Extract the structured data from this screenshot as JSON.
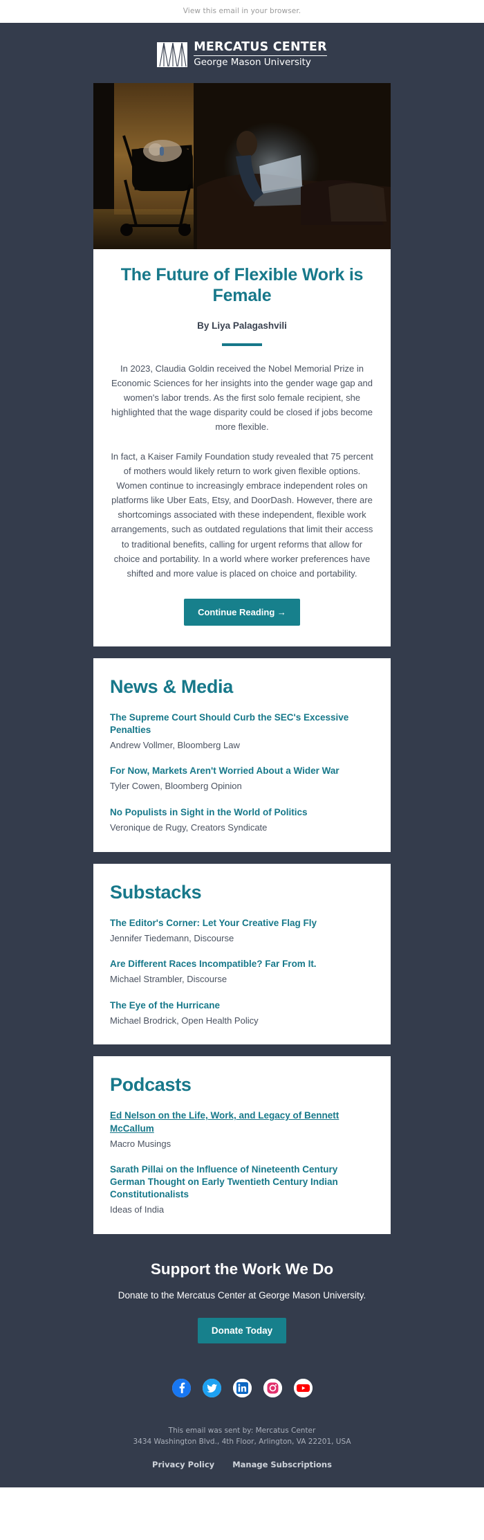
{
  "preheader": {
    "text": "View this email in your browser."
  },
  "brand": {
    "name_top": "MERCATUS CENTER",
    "name_bottom": "George Mason University",
    "logo_icon": "mercatus-logo-icon",
    "accent_teal": "#17788a",
    "button_teal": "#17808c",
    "navy": "#343c4c"
  },
  "hero": {
    "alt": "Woman working on a laptop at night beside a baby in a carrier"
  },
  "article": {
    "title": "The Future of Flexible Work is Female",
    "byline": "By Liya Palagashvili",
    "paragraphs": [
      "In 2023, Claudia Goldin received the Nobel Memorial Prize in Economic Sciences for her insights into the gender wage gap and women's labor trends. As the first solo female recipient, she highlighted that the wage disparity could be closed if jobs become more flexible.",
      "In fact, a Kaiser Family Foundation study revealed that 75 percent of mothers would likely return to work given flexible options. Women continue to increasingly embrace independent roles on platforms like Uber Eats, Etsy, and DoorDash. However, there are shortcomings associated with these independent, flexible work arrangements, such as outdated regulations that limit their access to traditional benefits, calling for urgent reforms that allow for choice and portability. In a world where worker preferences have shifted and more value is placed on choice and portability."
    ],
    "cta_label": "Continue Reading →"
  },
  "sections": [
    {
      "id": "news-media",
      "heading": "News & Media",
      "entries": [
        {
          "title": "The Supreme Court Should Curb the SEC's Excessive Penalties",
          "meta": "Andrew Vollmer, Bloomberg Law",
          "underlined": false
        },
        {
          "title": "For Now, Markets Aren't Worried About a Wider War",
          "meta": "Tyler Cowen, Bloomberg Opinion",
          "underlined": false
        },
        {
          "title": "No Populists in Sight in the World of Politics",
          "meta": "Veronique de Rugy, Creators Syndicate",
          "underlined": false
        }
      ]
    },
    {
      "id": "substacks",
      "heading": "Substacks",
      "entries": [
        {
          "title": "The Editor's Corner: Let Your Creative Flag Fly",
          "meta": "Jennifer Tiedemann, Discourse",
          "underlined": false
        },
        {
          "title": "Are Different Races Incompatible? Far From It.",
          "meta": "Michael Strambler, Discourse",
          "underlined": false
        },
        {
          "title": "The Eye of the Hurricane",
          "meta": "Michael Brodrick, Open Health Policy",
          "underlined": false
        }
      ]
    },
    {
      "id": "podcasts",
      "heading": "Podcasts",
      "entries": [
        {
          "title": "Ed Nelson on the Life, Work, and Legacy of Bennett McCallum",
          "meta": "Macro Musings",
          "underlined": true
        },
        {
          "title": "Sarath Pillai on the Influence of Nineteenth Century German Thought on Early Twentieth Century Indian Constitutionalists",
          "meta": "Ideas of India",
          "underlined": false
        }
      ]
    }
  ],
  "support": {
    "heading": "Support the Work We Do",
    "description": "Donate to the Mercatus Center at George Mason University.",
    "button_label": "Donate Today"
  },
  "social": [
    {
      "name": "facebook-icon",
      "label": "Facebook",
      "color": "#1877f2"
    },
    {
      "name": "twitter-icon",
      "label": "Twitter",
      "color": "#1da1f2"
    },
    {
      "name": "linkedin-icon",
      "label": "LinkedIn",
      "color": "#0a66c2"
    },
    {
      "name": "instagram-icon",
      "label": "Instagram",
      "color": "#e1306c"
    },
    {
      "name": "youtube-icon",
      "label": "YouTube",
      "color": "#ff0000"
    }
  ],
  "footer": {
    "sent_by": "This email was sent by: Mercatus Center",
    "address": "3434 Washington Blvd., 4th Floor, Arlington, VA 22201, USA",
    "privacy_label": "Privacy Policy",
    "manage_label": "Manage Subscriptions"
  }
}
